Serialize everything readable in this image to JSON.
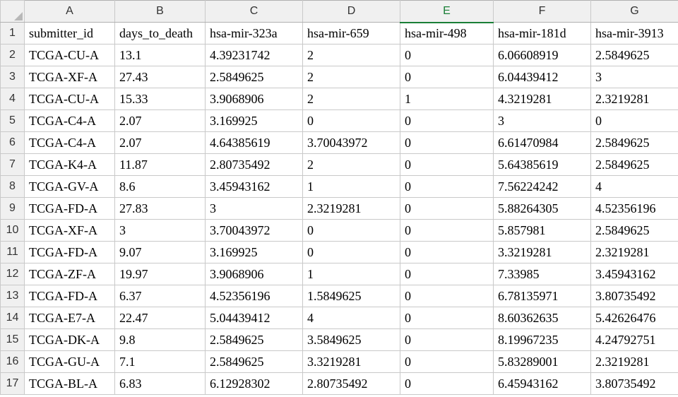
{
  "columns": [
    "A",
    "B",
    "C",
    "D",
    "E",
    "F",
    "G"
  ],
  "selected_column": "E",
  "headers": {
    "A": "submitter_id",
    "B": "days_to_death",
    "C": "hsa-mir-323a",
    "D": "hsa-mir-659",
    "E": "hsa-mir-498",
    "F": "hsa-mir-181d",
    "G": "hsa-mir-3913"
  },
  "rows": [
    {
      "num": "1"
    },
    {
      "num": "2",
      "A": "TCGA-CU-A",
      "B": "13.1",
      "C": "4.39231742",
      "D": "2",
      "E": "0",
      "F": "6.06608919",
      "G": "2.5849625"
    },
    {
      "num": "3",
      "A": "TCGA-XF-A",
      "B": "27.43",
      "C": "2.5849625",
      "D": "2",
      "E": "0",
      "F": "6.04439412",
      "G": "3"
    },
    {
      "num": "4",
      "A": "TCGA-CU-A",
      "B": "15.33",
      "C": "3.9068906",
      "D": "2",
      "E": "1",
      "F": "4.3219281",
      "G": "2.3219281"
    },
    {
      "num": "5",
      "A": "TCGA-C4-A",
      "B": "2.07",
      "C": "3.169925",
      "D": "0",
      "E": "0",
      "F": "3",
      "G": "0"
    },
    {
      "num": "6",
      "A": "TCGA-C4-A",
      "B": "2.07",
      "C": "4.64385619",
      "D": "3.70043972",
      "E": "0",
      "F": "6.61470984",
      "G": "2.5849625"
    },
    {
      "num": "7",
      "A": "TCGA-K4-A",
      "B": "11.87",
      "C": "2.80735492",
      "D": "2",
      "E": "0",
      "F": "5.64385619",
      "G": "2.5849625"
    },
    {
      "num": "8",
      "A": "TCGA-GV-A",
      "B": "8.6",
      "C": "3.45943162",
      "D": "1",
      "E": "0",
      "F": "7.56224242",
      "G": "4"
    },
    {
      "num": "9",
      "A": "TCGA-FD-A",
      "B": "27.83",
      "C": "3",
      "D": "2.3219281",
      "E": "0",
      "F": "5.88264305",
      "G": "4.52356196"
    },
    {
      "num": "10",
      "A": "TCGA-XF-A",
      "B": "3",
      "C": "3.70043972",
      "D": "0",
      "E": "0",
      "F": "5.857981",
      "G": "2.5849625"
    },
    {
      "num": "11",
      "A": "TCGA-FD-A",
      "B": "9.07",
      "C": "3.169925",
      "D": "0",
      "E": "0",
      "F": "3.3219281",
      "G": "2.3219281"
    },
    {
      "num": "12",
      "A": "TCGA-ZF-A",
      "B": "19.97",
      "C": "3.9068906",
      "D": "1",
      "E": "0",
      "F": "7.33985",
      "G": "3.45943162"
    },
    {
      "num": "13",
      "A": "TCGA-FD-A",
      "B": "6.37",
      "C": "4.52356196",
      "D": "1.5849625",
      "E": "0",
      "F": "6.78135971",
      "G": "3.80735492"
    },
    {
      "num": "14",
      "A": "TCGA-E7-A",
      "B": "22.47",
      "C": "5.04439412",
      "D": "4",
      "E": "0",
      "F": "8.60362635",
      "G": "5.42626476"
    },
    {
      "num": "15",
      "A": "TCGA-DK-A",
      "B": "9.8",
      "C": "2.5849625",
      "D": "3.5849625",
      "E": "0",
      "F": "8.19967235",
      "G": "4.24792751"
    },
    {
      "num": "16",
      "A": "TCGA-GU-A",
      "B": "7.1",
      "C": "2.5849625",
      "D": "3.3219281",
      "E": "0",
      "F": "5.83289001",
      "G": "2.3219281"
    },
    {
      "num": "17",
      "A": "TCGA-BL-A",
      "B": "6.83",
      "C": "6.12928302",
      "D": "2.80735492",
      "E": "0",
      "F": "6.45943162",
      "G": "3.80735492"
    }
  ]
}
